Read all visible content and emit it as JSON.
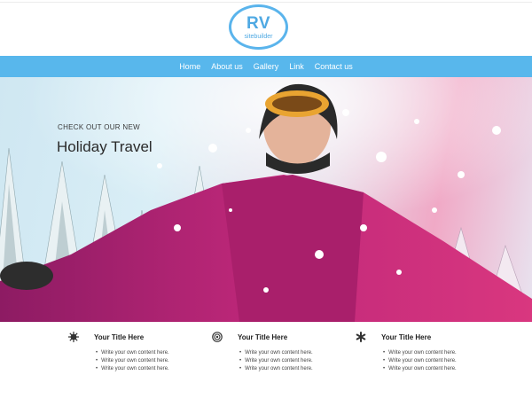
{
  "logo": {
    "main": "RV",
    "sub": "sitebuilder"
  },
  "nav": {
    "items": [
      "Home",
      "About us",
      "Gallery",
      "Link",
      "Contact us"
    ]
  },
  "hero": {
    "kicker": "CHECK OUT OUR NEW",
    "title": "Holiday Travel"
  },
  "features": [
    {
      "icon": "sunburst-icon",
      "title": "Your Title Here",
      "items": [
        "Write your own content here.",
        "Write your own content here.",
        "Write your own content here."
      ]
    },
    {
      "icon": "target-icon",
      "title": "Your Title Here",
      "items": [
        "Write your own content here.",
        "Write your own content here.",
        "Write your own content here."
      ]
    },
    {
      "icon": "asterisk-icon",
      "title": "Your Title Here",
      "items": [
        "Write your own content here.",
        "Write your own content here.",
        "Write your own content here."
      ]
    }
  ],
  "colors": {
    "accent": "#58b7ec",
    "text": "#222222",
    "jacket": "#b8236f"
  }
}
